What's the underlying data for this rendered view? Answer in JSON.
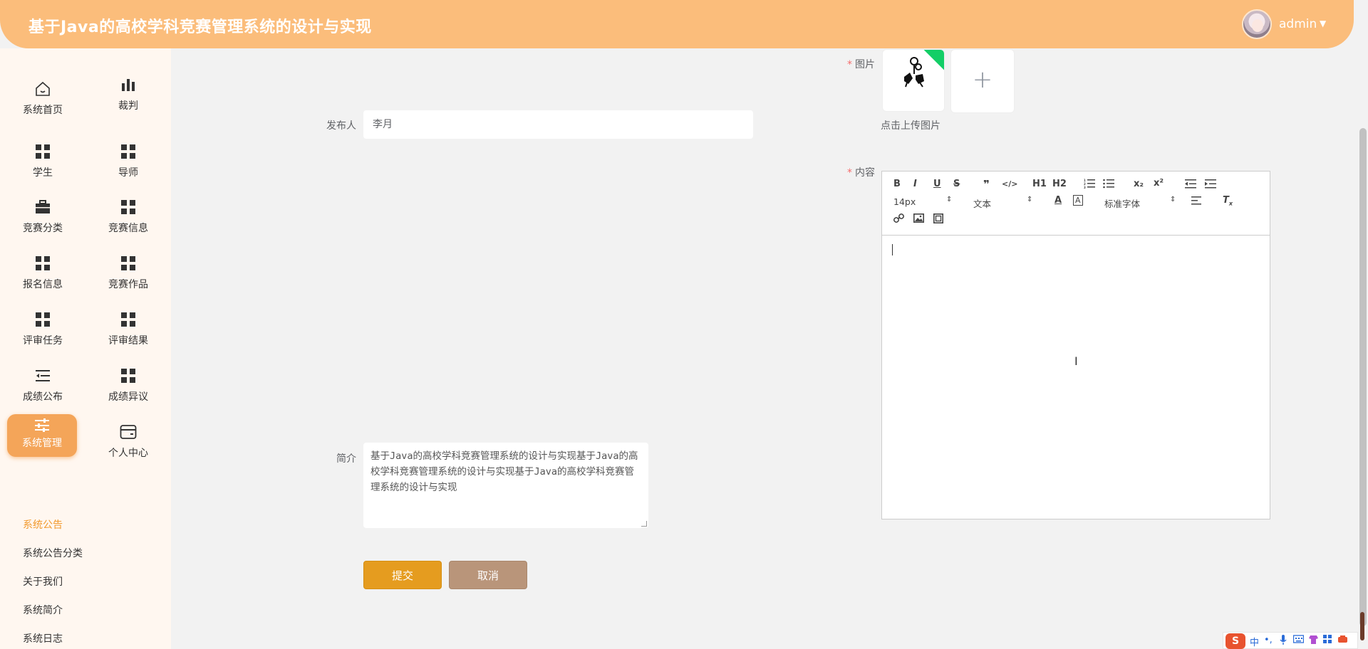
{
  "header": {
    "title": "基于Java的高校学科竞赛管理系统的设计与实现",
    "username": "admin",
    "caret": "▼"
  },
  "sidebar": {
    "items": [
      {
        "label": "系统首页",
        "icon": "home-icon"
      },
      {
        "label": "裁判",
        "icon": "bar-chart-icon"
      },
      {
        "label": "学生",
        "icon": "grid-icon"
      },
      {
        "label": "导师",
        "icon": "grid-icon"
      },
      {
        "label": "竞赛分类",
        "icon": "briefcase-icon"
      },
      {
        "label": "竞赛信息",
        "icon": "grid-icon"
      },
      {
        "label": "报名信息",
        "icon": "grid-icon"
      },
      {
        "label": "竞赛作品",
        "icon": "grid-icon"
      },
      {
        "label": "评审任务",
        "icon": "grid-icon"
      },
      {
        "label": "评审结果",
        "icon": "grid-icon"
      },
      {
        "label": "成绩公布",
        "icon": "list-indent-icon"
      },
      {
        "label": "成绩异议",
        "icon": "grid-icon"
      },
      {
        "label": "系统管理",
        "icon": "sliders-icon"
      },
      {
        "label": "个人中心",
        "icon": "wallet-icon"
      }
    ],
    "submenu": [
      "系统公告",
      "系统公告分类",
      "关于我们",
      "系统简介",
      "系统日志"
    ]
  },
  "form": {
    "image_label": "图片",
    "upload_tip": "点击上传图片",
    "publisher_label": "发布人",
    "publisher_value": "李月",
    "content_label": "内容",
    "intro_label": "简介",
    "intro_value": "基于Java的高校学科竞赛管理系统的设计与实现基于Java的高校学科竞赛管理系统的设计与实现基于Java的高校学科竞赛管理系统的设计与实现",
    "submit_label": "提交",
    "cancel_label": "取消"
  },
  "editor": {
    "font_size": "14px",
    "header_select": "文本",
    "font_family": "标准字体",
    "buttons": [
      "B",
      "I",
      "U",
      "S",
      "❞",
      "</>",
      "H1",
      "H2",
      "ordered-list",
      "bullet-list",
      "x₂",
      "x²",
      "outdent",
      "indent",
      "color",
      "background",
      "align",
      "clean",
      "link",
      "image",
      "video"
    ]
  },
  "ime": {
    "logo": "S",
    "mode": "中",
    "punct": "•,"
  }
}
